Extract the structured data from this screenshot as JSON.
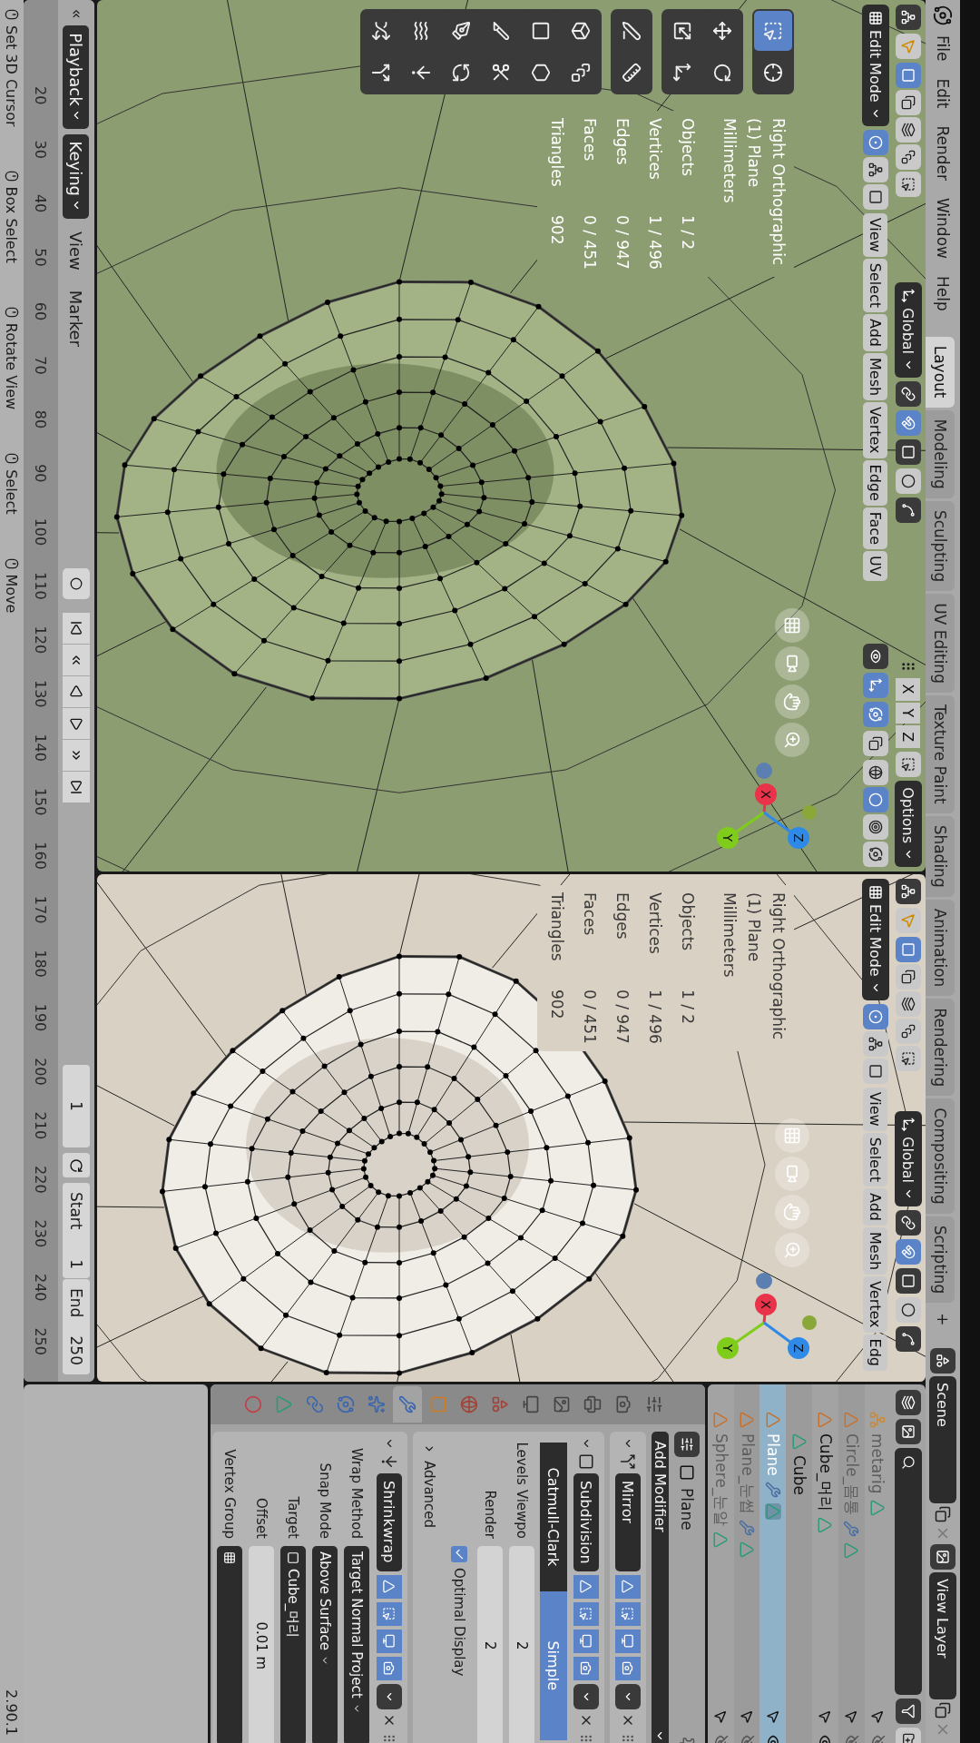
{
  "topbar": {
    "menus": [
      "File",
      "Edit",
      "Render",
      "Window",
      "Help"
    ],
    "workspaces": [
      {
        "label": "Layout",
        "selected": true
      },
      {
        "label": "Modeling",
        "selected": false
      },
      {
        "label": "Sculpting",
        "selected": false
      },
      {
        "label": "UV Editing",
        "selected": false
      },
      {
        "label": "Texture Paint",
        "selected": false
      },
      {
        "label": "Shading",
        "selected": false
      },
      {
        "label": "Animation",
        "selected": false
      },
      {
        "label": "Rendering",
        "selected": false
      },
      {
        "label": "Compositing",
        "selected": false
      },
      {
        "label": "Scripting",
        "selected": false
      }
    ],
    "add_workspace": "+",
    "scene": "Scene",
    "view_layer": "View Layer"
  },
  "viewports": [
    {
      "color": "#8d9d72",
      "mode": "Edit Mode",
      "orientation": "Global",
      "select_modes": [
        {
          "selected": true
        },
        {
          "selected": false
        },
        {
          "selected": false
        }
      ],
      "menus": [
        "View",
        "Select",
        "Add",
        "Mesh",
        "Vertex",
        "Edge",
        "Face",
        "UV"
      ],
      "snap": true,
      "axis_toggles": [
        "X",
        "Y",
        "Z"
      ],
      "options": "Options",
      "shading": [
        {
          "selected": false
        },
        {
          "selected": true
        },
        {
          "selected": false
        },
        {
          "selected": false
        }
      ],
      "overlay": [
        "Right Orthographic",
        "(1) Plane",
        "Millimeters"
      ],
      "stats": [
        {
          "label": "Objects",
          "value": "1 / 2"
        },
        {
          "label": "Vertices",
          "value": "1 / 496"
        },
        {
          "label": "Edges",
          "value": "0 / 947"
        },
        {
          "label": "Faces",
          "value": "0 / 451"
        },
        {
          "label": "Triangles",
          "value": "902"
        }
      ],
      "axes": [
        {
          "label": "X",
          "color": "#e8334a"
        },
        {
          "label": "Y",
          "color": "#7fcc1a"
        },
        {
          "label": "Z",
          "color": "#2e8ae6"
        }
      ],
      "tools": [
        {
          "selected": true
        },
        {
          "selected": false
        },
        {
          "selected": false
        },
        {
          "selected": false
        },
        {
          "selected": false
        },
        {
          "selected": false
        },
        {
          "selected": false
        },
        {
          "selected": false
        },
        {
          "selected": false
        },
        {
          "selected": false
        },
        {
          "selected": false
        },
        {
          "selected": false
        },
        {
          "selected": false
        },
        {
          "selected": false
        },
        {
          "selected": false
        },
        {
          "selected": false
        },
        {
          "selected": false
        },
        {
          "selected": false
        },
        {
          "selected": false
        },
        {
          "selected": false
        }
      ]
    },
    {
      "color": "#d9d1c3",
      "mode": "Edit Mode",
      "orientation": "Global",
      "select_modes": [
        {
          "selected": true
        },
        {
          "selected": false
        },
        {
          "selected": false
        }
      ],
      "menus": [
        "View",
        "Select",
        "Add",
        "Mesh",
        "Vertex",
        "Edg"
      ],
      "snap": true,
      "overlay": [
        "Right Orthographic",
        "(1) Plane",
        "Millimeters"
      ],
      "stats": [
        {
          "label": "Objects",
          "value": "1 / 2"
        },
        {
          "label": "Vertices",
          "value": "1 / 496"
        },
        {
          "label": "Edges",
          "value": "0 / 947"
        },
        {
          "label": "Faces",
          "value": "0 / 451"
        },
        {
          "label": "Triangles",
          "value": "902"
        }
      ],
      "axes": [
        {
          "label": "X",
          "color": "#e8334a"
        },
        {
          "label": "Y",
          "color": "#7fcc1a"
        },
        {
          "label": "Z",
          "color": "#2e8ae6"
        }
      ]
    }
  ],
  "timeline": {
    "menus": [
      {
        "label": "Playback",
        "dropdown": true
      },
      {
        "label": "Keying",
        "dropdown": true
      },
      {
        "label": "View",
        "dropdown": false
      },
      {
        "label": "Marker",
        "dropdown": false
      }
    ],
    "current_frame": "1",
    "start_label": "Start",
    "start": "1",
    "end_label": "End",
    "end": "250",
    "ticks": [
      "20",
      "30",
      "40",
      "50",
      "60",
      "70",
      "80",
      "90",
      "100",
      "110",
      "120",
      "130",
      "140",
      "150",
      "160",
      "170",
      "180",
      "190",
      "200",
      "210",
      "220",
      "230",
      "240",
      "250"
    ]
  },
  "outliner": {
    "rows": [
      {
        "name": "metarig",
        "kind": "armature",
        "hidden": true,
        "selected": false,
        "modifier": false
      },
      {
        "name": "Circle_몸통",
        "kind": "mesh",
        "hidden": true,
        "selected": false,
        "modifier": true
      },
      {
        "name": "Cube_머리",
        "kind": "mesh",
        "hidden": false,
        "selected": false,
        "modifier": false,
        "children": [
          {
            "name": "Cube",
            "kind": "mesh-data",
            "hidden": false,
            "selected": false,
            "modifier": false
          }
        ]
      },
      {
        "name": "Plane",
        "kind": "mesh",
        "hidden": false,
        "selected": true,
        "modifier": true
      },
      {
        "name": "Plane_눈썹",
        "kind": "mesh",
        "hidden": true,
        "selected": false,
        "modifier": true
      },
      {
        "name": "Sphere_눈알",
        "kind": "mesh",
        "hidden": true,
        "selected": false,
        "modifier": false
      }
    ]
  },
  "properties": {
    "object": "Plane",
    "add_modifier": "Add Modifier",
    "tabs": [
      {
        "selected": false
      },
      {
        "selected": false
      },
      {
        "selected": false
      },
      {
        "selected": false
      },
      {
        "selected": false
      },
      {
        "selected": false
      },
      {
        "selected": false
      },
      {
        "selected": false
      },
      {
        "selected": true
      },
      {
        "selected": false
      },
      {
        "selected": false
      },
      {
        "selected": false
      },
      {
        "selected": false
      },
      {
        "selected": false
      }
    ],
    "modifiers": [
      {
        "kind": "mirror",
        "name": "Mirror",
        "toggles": [
          {
            "on": true
          },
          {
            "on": true
          },
          {
            "on": true
          },
          {
            "on": true
          }
        ]
      },
      {
        "kind": "subdivision",
        "name": "Subdivision",
        "toggles": [
          {
            "on": true
          },
          {
            "on": true
          },
          {
            "on": true
          },
          {
            "on": true
          }
        ],
        "segments": [
          {
            "label": "Catmull-Clark",
            "selected": false
          },
          {
            "label": "Simple",
            "selected": true
          }
        ],
        "fields": [
          {
            "label": "Levels Viewpo",
            "value": "2"
          },
          {
            "label": "Render",
            "value": "2"
          }
        ],
        "checkbox": {
          "label": "Optimal Display",
          "checked": true
        },
        "advanced": {
          "label": "Advanced",
          "expanded": false
        }
      },
      {
        "kind": "shrinkwrap",
        "name": "Shrinkwrap",
        "toggles": [
          {
            "on": true
          },
          {
            "on": true
          },
          {
            "on": true
          },
          {
            "on": true
          }
        ],
        "fields": [
          {
            "kind": "dropdown",
            "label": "Wrap Method",
            "value": "Target Normal Project"
          },
          {
            "kind": "dropdown",
            "label": "Snap Mode",
            "value": "Above Surface"
          },
          {
            "kind": "object",
            "label": "Target",
            "value": "Cube_머리"
          },
          {
            "kind": "number",
            "label": "Offset",
            "value": "0.01 m"
          },
          {
            "kind": "group",
            "label": "Vertex Group"
          }
        ]
      }
    ]
  },
  "status": {
    "items": [
      "Set 3D Cursor",
      "Box Select",
      "Rotate View",
      "Select",
      "Move"
    ],
    "version": "2.90.1"
  }
}
